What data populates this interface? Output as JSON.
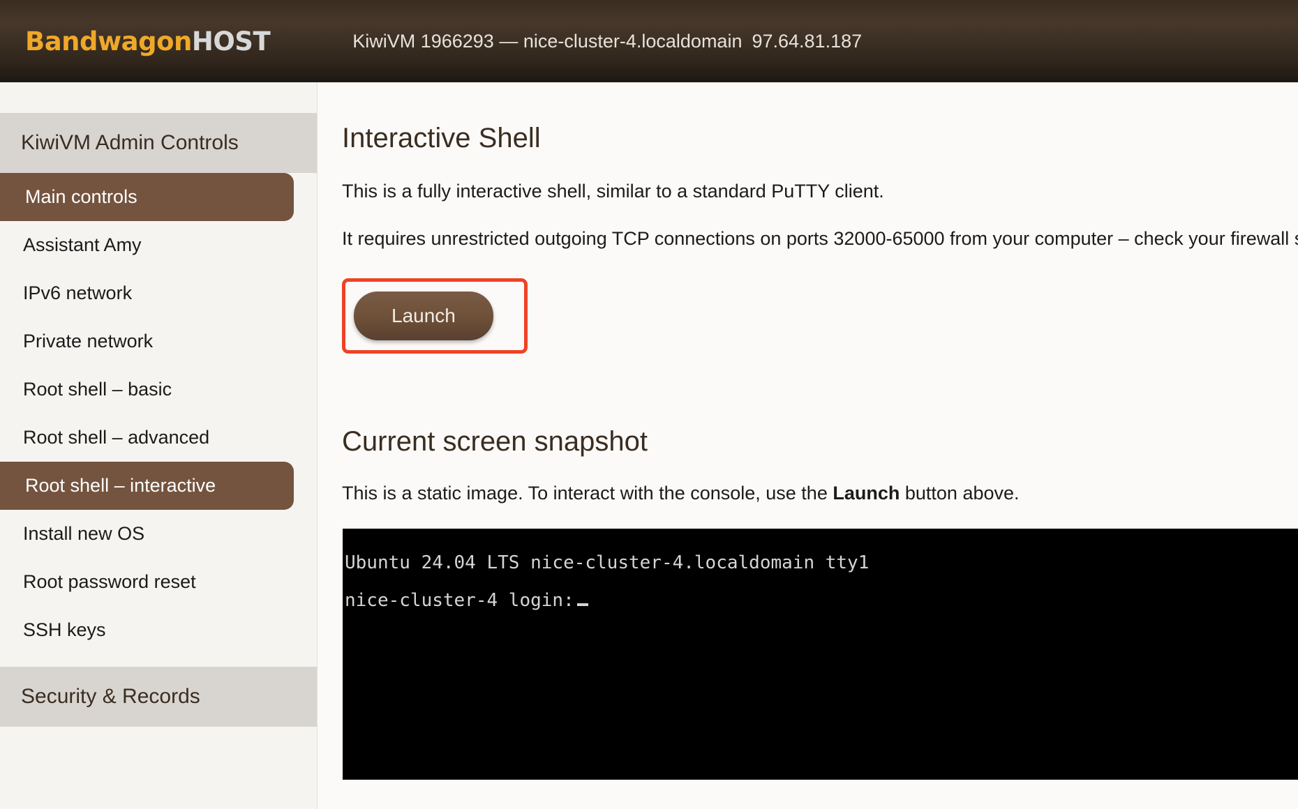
{
  "header": {
    "brand_prefix": "Bandwagon",
    "brand_suffix": "HOST",
    "vm_label": "KiwiVM 1966293 — nice-cluster-4.localdomain",
    "vm_ip": "97.64.81.187"
  },
  "sidebar": {
    "sections": [
      {
        "title": "KiwiVM Admin Controls",
        "items": [
          {
            "label": "Main controls",
            "active": true
          },
          {
            "label": "Assistant Amy",
            "active": false
          },
          {
            "label": "IPv6 network",
            "active": false
          },
          {
            "label": "Private network",
            "active": false
          },
          {
            "label": "Root shell – basic",
            "active": false
          },
          {
            "label": "Root shell – advanced",
            "active": false
          },
          {
            "label": "Root shell – interactive",
            "active": true
          },
          {
            "label": "Install new OS",
            "active": false
          },
          {
            "label": "Root password reset",
            "active": false
          },
          {
            "label": "SSH keys",
            "active": false
          }
        ]
      },
      {
        "title": "Security & Records",
        "items": []
      }
    ]
  },
  "main": {
    "shell_heading": "Interactive Shell",
    "shell_desc": "This is a fully interactive shell, similar to a standard PuTTY client.",
    "shell_requirements": "It requires unrestricted outgoing TCP connections on ports 32000-65000 from your computer – check your firewall settings",
    "launch_label": "Launch",
    "snapshot_heading": "Current screen snapshot",
    "snapshot_desc_before": "This is a static image. To interact with the console, use the ",
    "snapshot_desc_bold": "Launch",
    "snapshot_desc_after": " button above.",
    "terminal": {
      "line1": "Ubuntu 24.04 LTS nice-cluster-4.localdomain tty1",
      "line2": "nice-cluster-4 login:"
    }
  },
  "colors": {
    "accent_brown": "#74543f",
    "brand_orange": "#f0a829",
    "highlight_red": "#ef4323",
    "topbar_dark": "#3a2d21"
  }
}
